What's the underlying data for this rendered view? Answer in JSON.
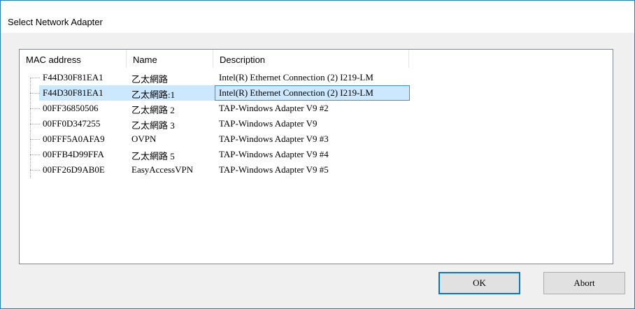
{
  "window": {
    "title": "Select Network Adapter"
  },
  "table": {
    "columns": [
      "MAC address",
      "Name",
      "Description"
    ],
    "rows": [
      {
        "mac": "F44D30F81EA1",
        "name": "乙太網路",
        "description": "Intel(R) Ethernet Connection (2) I219-LM",
        "selected": false
      },
      {
        "mac": "F44D30F81EA1",
        "name": "乙太網路:1",
        "description": "Intel(R) Ethernet Connection (2) I219-LM",
        "selected": true
      },
      {
        "mac": "00FF36850506",
        "name": "乙太網路 2",
        "description": "TAP-Windows Adapter V9 #2",
        "selected": false
      },
      {
        "mac": "00FF0D347255",
        "name": "乙太網路 3",
        "description": "TAP-Windows Adapter V9",
        "selected": false
      },
      {
        "mac": "00FFF5A0AFA9",
        "name": "OVPN",
        "description": "TAP-Windows Adapter V9 #3",
        "selected": false
      },
      {
        "mac": "00FFB4D99FFA",
        "name": "乙太網路 5",
        "description": "TAP-Windows Adapter V9 #4",
        "selected": false
      },
      {
        "mac": "00FF26D9AB0E",
        "name": "EasyAccessVPN",
        "description": "TAP-Windows Adapter V9 #5",
        "selected": false
      }
    ]
  },
  "buttons": {
    "ok": "OK",
    "abort": "Abort"
  },
  "colors": {
    "selection": "#cce8ff",
    "focus": "#3c8ddb",
    "accent": "#0078d7"
  }
}
